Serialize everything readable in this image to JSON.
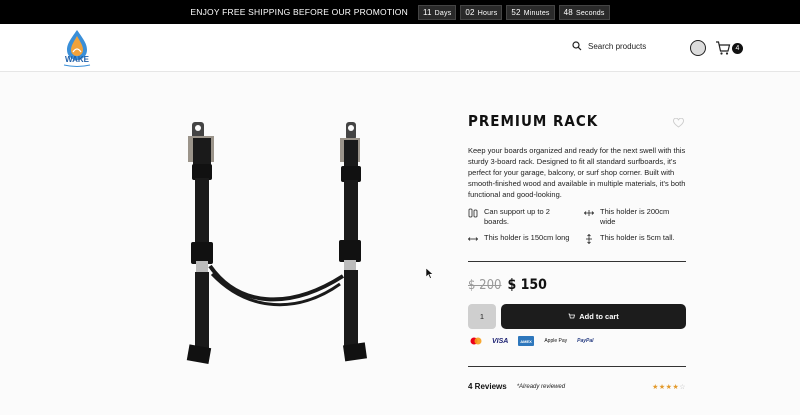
{
  "announcement": {
    "message": "ENJOY FREE SHIPPING BEFORE OUR PROMOTION",
    "countdown": [
      {
        "value": "11",
        "unit": "Days"
      },
      {
        "value": "02",
        "unit": "Hours"
      },
      {
        "value": "52",
        "unit": "Minutes"
      },
      {
        "value": "48",
        "unit": "Seconds"
      }
    ]
  },
  "header": {
    "logo_text": "WAKE",
    "search_label": "Search products",
    "cart_count": "4"
  },
  "product": {
    "title": "PREMIUM RACK",
    "description": "Keep your boards organized and ready for the next swell with this sturdy 3-board rack. Designed to fit all standard surfboards, it's perfect for your garage, balcony, or surf shop corner. Built with smooth-finished wood and available in multiple materials, it's both functional and good-looking.",
    "features": [
      {
        "icon": "boards-icon",
        "text": "Can support up to 2 boards."
      },
      {
        "icon": "width-arrows-icon",
        "text": "This holder is 200cm wide"
      },
      {
        "icon": "length-arrows-icon",
        "text": "This holder is 150cm long"
      },
      {
        "icon": "height-arrows-icon",
        "text": "This holder is 5cm tall."
      }
    ],
    "price_old": "$ 200",
    "price_new": "$ 150",
    "quantity": "1",
    "add_to_cart": "Add to cart",
    "payment_methods": [
      "Mastercard",
      "VISA",
      "AMEX",
      "Apple Pay",
      "PayPal"
    ],
    "reviews": {
      "count_label": "4 Reviews",
      "note": "*Already reviewed",
      "rating": 4,
      "max_rating": 5
    }
  },
  "colors": {
    "accent": "#1c1c1c",
    "star": "#e39a2c",
    "background": "#fbfbfb"
  }
}
